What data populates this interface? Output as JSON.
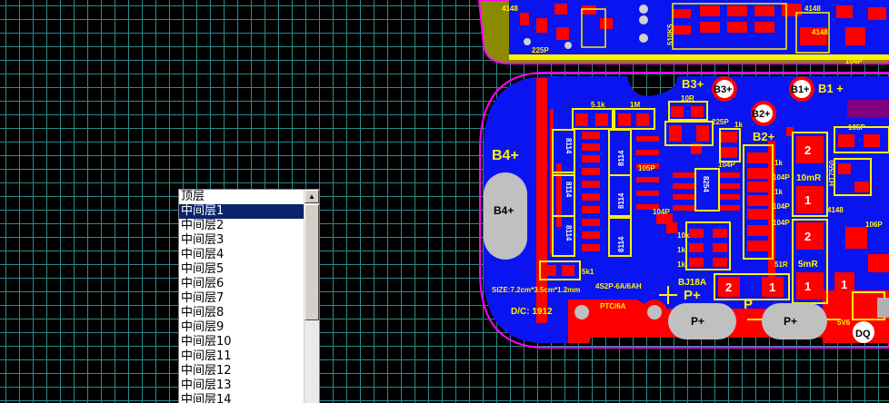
{
  "layer_list": {
    "items": [
      "顶层",
      "中间层1",
      "中间层2",
      "中间层3",
      "中间层4",
      "中间层5",
      "中间层6",
      "中间层7",
      "中间层8",
      "中间层9",
      "中间层10",
      "中间层11",
      "中间层12",
      "中间层13",
      "中间层14"
    ],
    "selected_index": 1,
    "scroll_up_glyph": "▲"
  },
  "pcb_labels": {
    "b4_plus": "B4+",
    "b4_pad": "B4+",
    "b3_plus": "B3+",
    "b3_pad": "B3+",
    "b1_pad": "B1+",
    "b1_plus": "B1 +",
    "b2_pad": "B2+",
    "b2_plus": "B2+",
    "r_5_1k": "5.1k",
    "r_1m": "1M",
    "r_10r": "10R",
    "c_225p_top": "225P",
    "c_225p": "225P",
    "ic_8114_a": "8114",
    "ic_8114_b": "8114",
    "ic_8114_c": "8114",
    "ic_8114_d": "8114",
    "ic_8114_e": "8114",
    "ic_8114_f": "8114",
    "ic_8254": "8254",
    "c_105p": "105P",
    "c_104p_a": "104P",
    "c_104p_b": "104P",
    "c_104p_c": "104P",
    "c_104p_d": "104P",
    "c_104p_e": "104P",
    "r_1k_a": "1k",
    "r_1k_b": "1k",
    "r_1k_c": "1k",
    "r_1k_d": "1k",
    "r_1k_e": "1k",
    "r_10k": "10k",
    "r_51r": "51R",
    "r_5k1": "5k1",
    "r_10mr": "10mR",
    "r_5mr": "5mR",
    "ht7550": "HT7550",
    "c_105p_r": "105P",
    "d_4148": "4148",
    "d_4148_top": "4148",
    "d_4148_top2": "4148",
    "c_106p": "106P",
    "size_note": "SIZE:7.2cm*3.5cm*1.2mm",
    "model_note": "4S2P-6A/6AH",
    "date_note": "D/C: 1912",
    "ptc": "PTC/6A",
    "bj18a": "BJ18A",
    "p_plus_label": "P+",
    "p_minus_label": "P",
    "p_plus_pad": "P+",
    "p_minus_pad": "P+",
    "dq": "DQ",
    "v5v6": "5V6",
    "num_2a": "2",
    "num_1a": "1",
    "num_2b": "2",
    "num_1b": "1",
    "num_2c": "2",
    "num_1c": "1",
    "num_1d": "1",
    "top_510k": "510K5",
    "top_104p": "104P",
    "top_4148": "4148"
  },
  "colors": {
    "grid": "#2a8a8a",
    "board_blue": "#0a14f0",
    "copper_red": "#ff0000",
    "silkscreen_yellow": "#fff200",
    "outline_magenta": "#ff00ff",
    "selection": "#0a246a"
  }
}
